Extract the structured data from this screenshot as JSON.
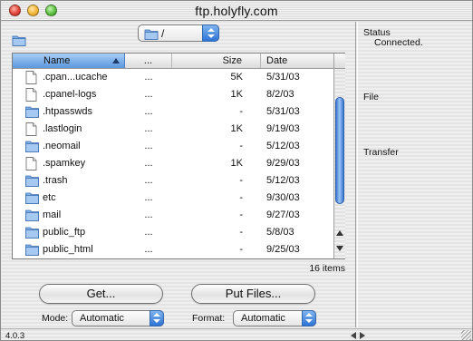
{
  "window": {
    "title": "ftp.holyfly.com"
  },
  "path": {
    "current": "/"
  },
  "list": {
    "headers": {
      "name": "Name",
      "dots": "...",
      "size": "Size",
      "date": "Date"
    },
    "rows": [
      {
        "type": "file",
        "name": ".cpan...ucache",
        "dots": "...",
        "size": "5K",
        "date": "5/31/03"
      },
      {
        "type": "file",
        "name": ".cpanel-logs",
        "dots": "...",
        "size": "1K",
        "date": "8/2/03"
      },
      {
        "type": "folder",
        "name": ".htpasswds",
        "dots": "...",
        "size": "-",
        "date": "5/31/03"
      },
      {
        "type": "file",
        "name": ".lastlogin",
        "dots": "...",
        "size": "1K",
        "date": "9/19/03"
      },
      {
        "type": "folder",
        "name": ".neomail",
        "dots": "...",
        "size": "-",
        "date": "5/12/03"
      },
      {
        "type": "file",
        "name": ".spamkey",
        "dots": "...",
        "size": "1K",
        "date": "9/29/03"
      },
      {
        "type": "folder",
        "name": ".trash",
        "dots": "...",
        "size": "-",
        "date": "5/12/03"
      },
      {
        "type": "folder",
        "name": "etc",
        "dots": "...",
        "size": "-",
        "date": "9/30/03"
      },
      {
        "type": "folder",
        "name": "mail",
        "dots": "...",
        "size": "-",
        "date": "9/27/03"
      },
      {
        "type": "folder",
        "name": "public_ftp",
        "dots": "...",
        "size": "-",
        "date": "5/8/03"
      },
      {
        "type": "folder",
        "name": "public_html",
        "dots": "...",
        "size": "-",
        "date": "9/25/03"
      }
    ],
    "count": "16 items",
    "scroll_position": 0.55
  },
  "buttons": {
    "get": "Get...",
    "put": "Put Files..."
  },
  "mode": {
    "label": "Mode:",
    "value": "Automatic"
  },
  "format": {
    "label": "Format:",
    "value": "Automatic"
  },
  "version": "4.0.3",
  "panel": {
    "status_label": "Status",
    "status_value": "Connected.",
    "file_label": "File",
    "transfer_label": "Transfer"
  },
  "colors": {
    "accent": "#3a78d4",
    "folder": "#7fb0e8",
    "header_selected": "#5b98de"
  }
}
